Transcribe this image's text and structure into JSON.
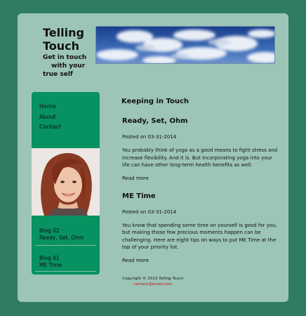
{
  "header": {
    "title": "Telling Touch",
    "tagline_line1": "Get in touch",
    "tagline_line2": "with your",
    "tagline_line3": "true self"
  },
  "nav": {
    "items": [
      "Home",
      "About",
      "Contact"
    ]
  },
  "sidebar_posts": [
    {
      "title": "Blog 02",
      "subtitle": "Ready, Set, Ohm"
    },
    {
      "title": "Blog 01",
      "subtitle": "ME Time"
    }
  ],
  "main": {
    "section_title": "Keeping in Touch",
    "posts": [
      {
        "title": "Ready, Set, Ohm",
        "posted": "Posted on 03-31-2014",
        "excerpt": "You probably think of yoga as a good means to fight stress and increase flexibility. And it is. But incorporating yoga into your life can have other long-term health benefits as well.",
        "read_more": "Read more"
      },
      {
        "title": "ME Time",
        "posted": "Posted on 03-31-2014",
        "excerpt": "You know that spending some time on yourself is good for you, but making those few precious moments happen can be challenging. Here are eight tips on ways to put ME Time at the top of your priority list.",
        "read_more": "Read more"
      }
    ]
  },
  "footer": {
    "copyright": "Copyright © 2013",
    "owner": "Telling Touch",
    "email": "contact@email.com"
  },
  "colors": {
    "background": "#2e7d63",
    "page": "#9cc5b8",
    "sidebar": "#089161",
    "link_red": "#c0121c"
  }
}
